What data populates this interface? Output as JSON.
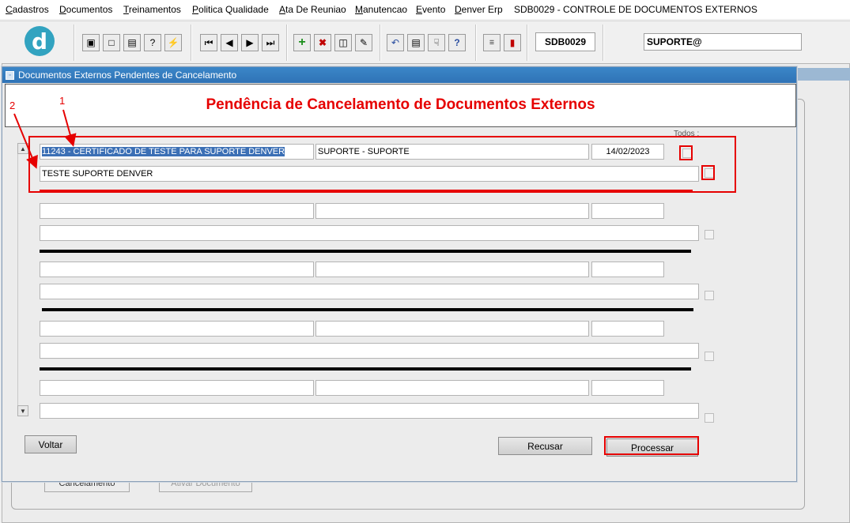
{
  "menu": {
    "items": [
      {
        "u": "C",
        "rest": "adastros"
      },
      {
        "u": "D",
        "rest": "ocumentos"
      },
      {
        "u": "T",
        "rest": "reinamentos"
      },
      {
        "u": "P",
        "rest": "olitica Qualidade"
      },
      {
        "u": "A",
        "rest": "ta De Reuniao"
      },
      {
        "u": "M",
        "rest": "anutencao"
      },
      {
        "u": "E",
        "rest": "vento"
      },
      {
        "u": "D",
        "rest": "enver Erp"
      }
    ],
    "screen_title": "SDB0029 - CONTROLE DE DOCUMENTOS EXTERNOS"
  },
  "toolbar": {
    "logo_letter": "d",
    "program_code": "SDB0029",
    "user": "SUPORTE@",
    "icons": [
      "save-icon",
      "window-icon",
      "print-icon",
      "query-help-icon",
      "execute-query-icon",
      "first-record-icon",
      "prev-record-icon",
      "next-record-icon",
      "last-record-icon",
      "insert-record-icon",
      "delete-record-icon",
      "clear-record-icon",
      "edit-icon",
      "undo-icon",
      "clipboard-icon",
      "hand-pointer-icon",
      "help-icon",
      "menu-icon",
      "exit-icon"
    ]
  },
  "background": {
    "btn1": "Cancelamento",
    "btn2": "Ativar Documento"
  },
  "dialog": {
    "window_title": "Documentos Externos Pendentes de Cancelamento",
    "heading": "Pendência de Cancelamento de Documentos Externos",
    "todos_label": "Todos :",
    "annotation_1": "1",
    "annotation_2": "2",
    "records": [
      {
        "document": "11243 - CERTIFICADO DE TESTE PARA SUPORTE DENVER",
        "responsible": "SUPORTE - SUPORTE",
        "date": "14/02/2023",
        "description": "TESTE SUPORTE DENVER"
      },
      {
        "document": "",
        "responsible": "",
        "date": "",
        "description": ""
      },
      {
        "document": "",
        "responsible": "",
        "date": "",
        "description": ""
      },
      {
        "document": "",
        "responsible": "",
        "date": "",
        "description": ""
      },
      {
        "document": "",
        "responsible": "",
        "date": "",
        "description": ""
      }
    ],
    "buttons": {
      "back": "Voltar",
      "reject": "Recusar",
      "process": "Processar"
    }
  },
  "colors": {
    "highlight_red": "#e60000",
    "title_bar_blue": "#2f73b6",
    "logo_blue": "#32a3c0"
  }
}
